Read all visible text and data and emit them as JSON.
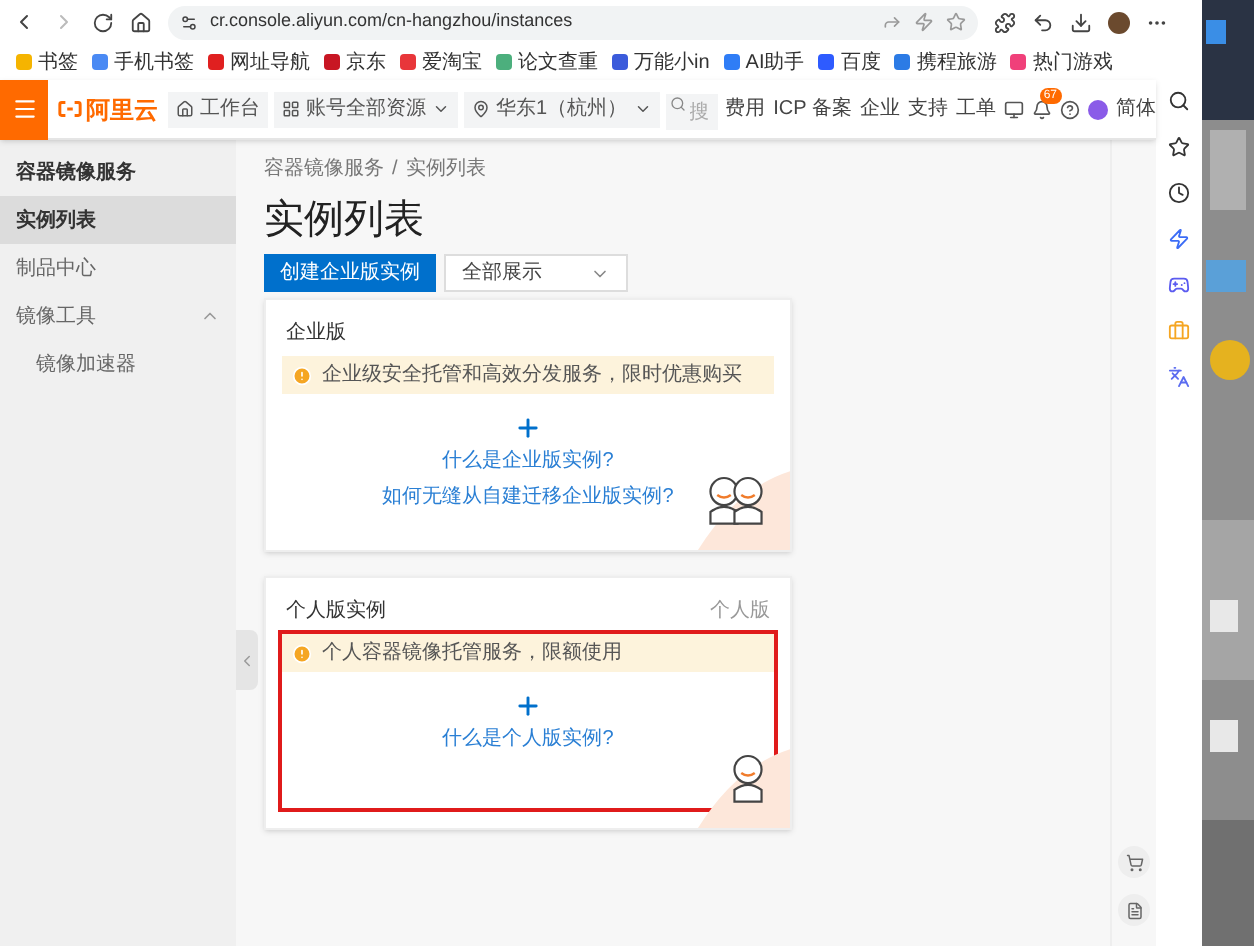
{
  "browser": {
    "url": "cr.console.aliyun.com/cn-hangzhou/instances"
  },
  "bookmarks": [
    {
      "label": "书签",
      "color": "#f5b400"
    },
    {
      "label": "手机书签",
      "color": "#4a8af4"
    },
    {
      "label": "网址导航",
      "color": "#e02020"
    },
    {
      "label": "京东",
      "color": "#c81623"
    },
    {
      "label": "爱淘宝",
      "color": "#e8363a"
    },
    {
      "label": "论文查重",
      "color": "#4caf7d"
    },
    {
      "label": "万能小in",
      "color": "#3b5bdb"
    },
    {
      "label": "AI助手",
      "color": "#2f7df6"
    },
    {
      "label": "百度",
      "color": "#2e5bff"
    },
    {
      "label": "携程旅游",
      "color": "#2c7be5"
    },
    {
      "label": "热门游戏",
      "color": "#f0407a"
    }
  ],
  "header": {
    "logo": "阿里云",
    "workbench": "工作台",
    "resources": "账号全部资源",
    "region": "华东1（杭州）",
    "search_placeholder": "搜",
    "nav": [
      "费用",
      "ICP 备案",
      "企业",
      "支持",
      "工单"
    ],
    "badge": "67",
    "language": "简体"
  },
  "sidebar": {
    "title": "容器镜像服务",
    "items": [
      {
        "label": "实例列表",
        "selected": true
      },
      {
        "label": "制品中心",
        "selected": false
      },
      {
        "label": "镜像工具",
        "selected": false,
        "expanded": true,
        "children": [
          {
            "label": "镜像加速器",
            "selected": false
          }
        ]
      }
    ]
  },
  "breadcrumb": [
    "容器镜像服务",
    "/",
    "实例列表"
  ],
  "page_title": "实例列表",
  "create_button": "创建企业版实例",
  "filter": {
    "value": "全部展示"
  },
  "cards": [
    {
      "title": "企业版",
      "notice": "企业级安全托管和高效分发服务，限时优惠购买",
      "links": [
        "什么是企业版实例?",
        "如何无缝从自建迁移企业版实例?"
      ],
      "highlighted": false
    },
    {
      "title": "个人版实例",
      "tag": "个人版",
      "notice": "个人容器镜像托管服务，限额使用",
      "links": [
        "什么是个人版实例?"
      ],
      "highlighted": true
    }
  ]
}
